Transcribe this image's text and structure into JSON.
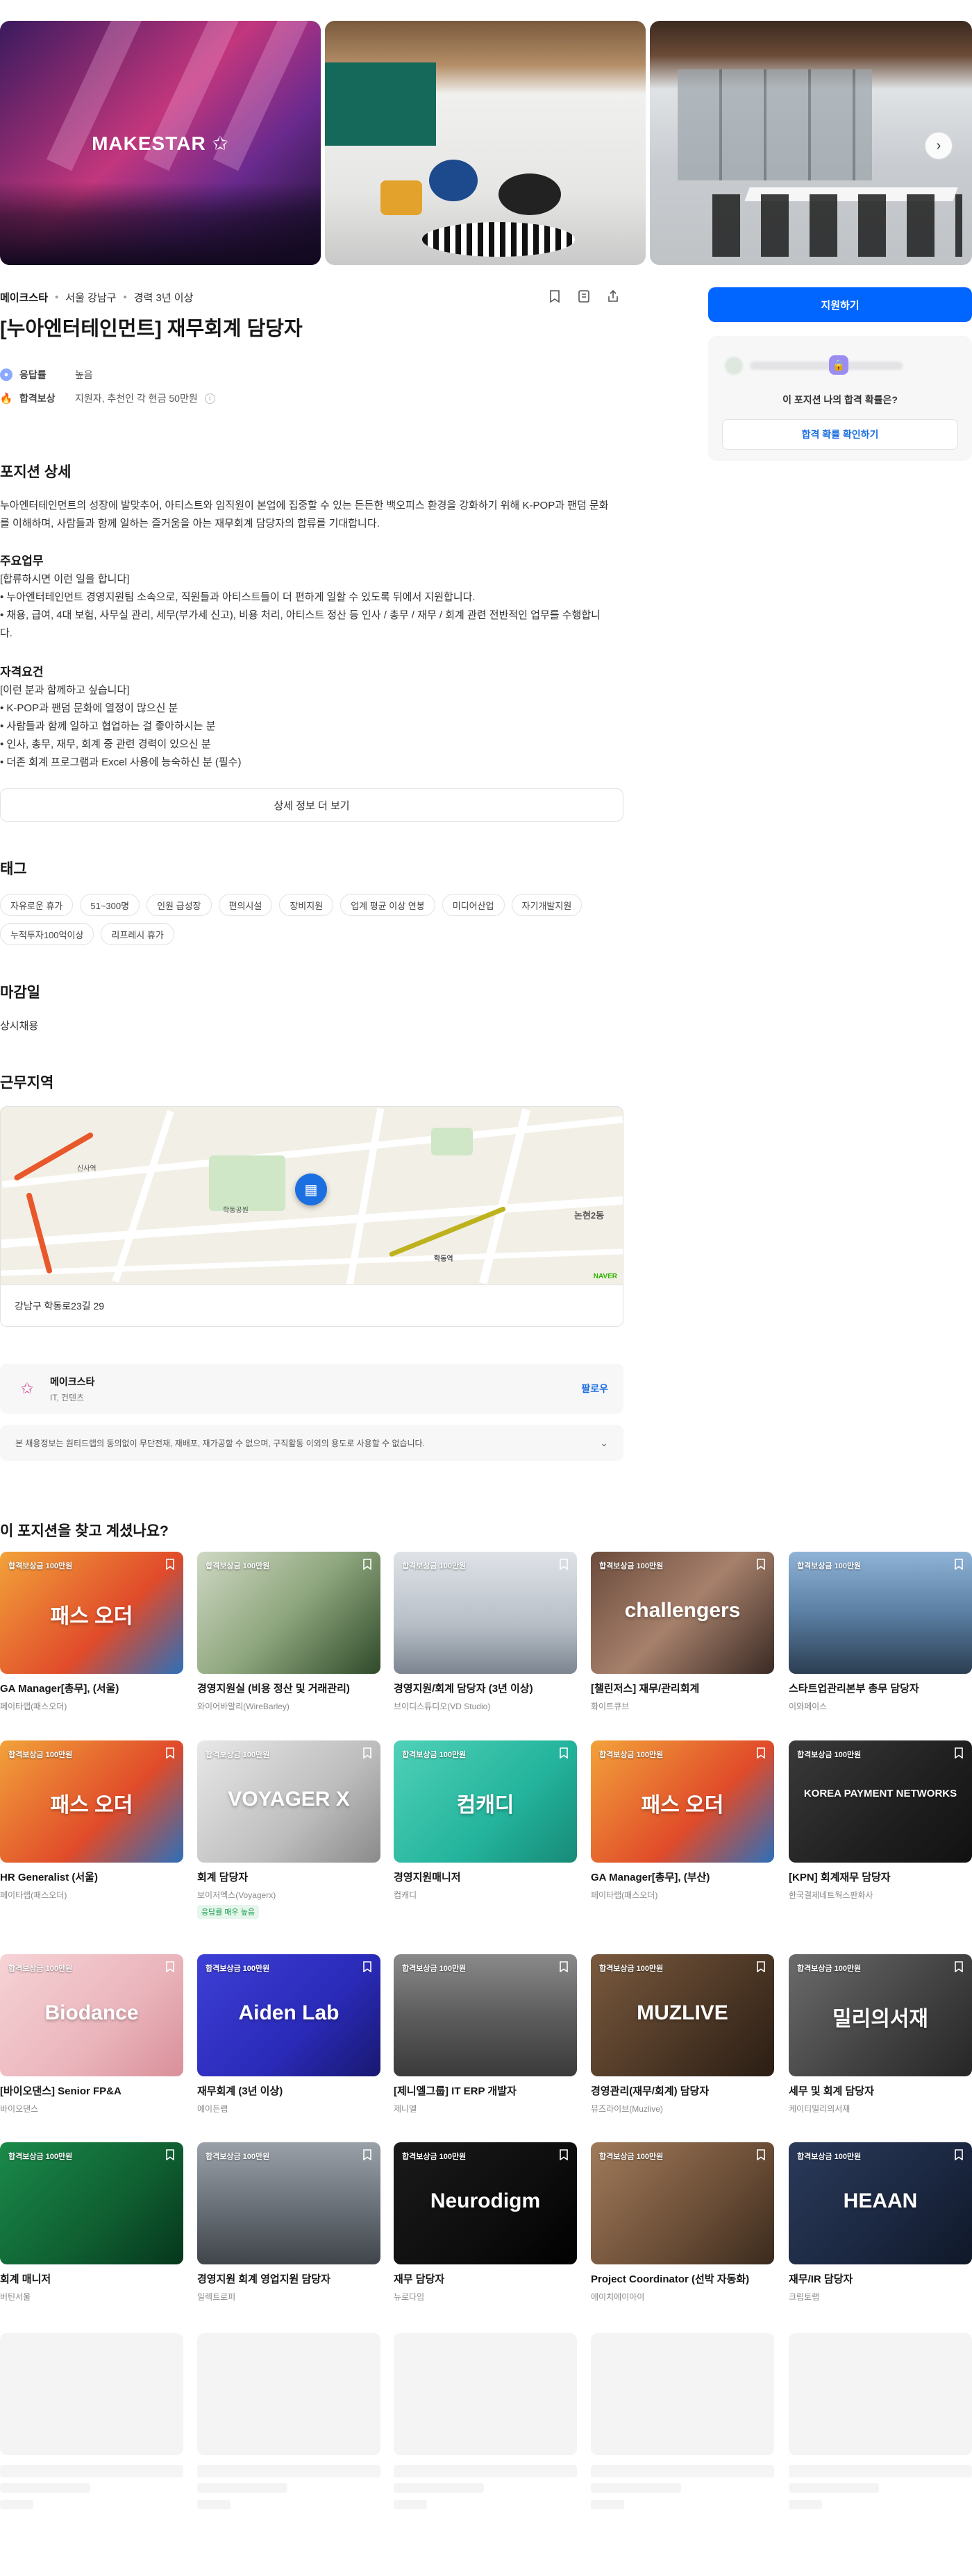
{
  "gallery": {
    "logo_text": "MAKESTAR ✩",
    "next_icon": "chevron-right-icon"
  },
  "header": {
    "company": "메이크스타",
    "location": "서울 강남구",
    "experience": "경력 3년 이상",
    "title": "[누아엔터테인먼트] 재무회계 담당자",
    "icons": [
      "bookmark-icon",
      "share-doc-icon",
      "share-icon"
    ]
  },
  "metrics": [
    {
      "icon": "response-icon",
      "label": "응답률",
      "value": "높음",
      "color": "#8aa8ff"
    },
    {
      "icon": "fire-icon",
      "label": "합격보상",
      "value": "지원자, 추천인 각 현금 50만원",
      "color": "#ff8c2b"
    }
  ],
  "detail": {
    "heading": "포지션 상세",
    "intro_1": "누아엔터테인먼트의 성장에 발맞추어, 아티스트와 임직원이 본업에 집중할 수 있는 든든한 백오피스 환경을 강화하기 위해 K-POP과 팬덤 문화",
    "intro_2": "를 이해하며, 사람들과 함께 일하는 즐거움을 아는 재무회계 담당자의 합류를 기대합니다.",
    "duty_heading": "주요업무",
    "duty_lines": [
      "[합류하시면 이런 일을 합니다]",
      "• 누아엔터테인먼트 경영지원팀 소속으로, 직원들과 아티스트들이 더 편하게 일할 수 있도록 뒤에서 지원합니다.",
      "• 채용, 급여, 4대 보험, 사무실 관리, 세무(부가세 신고), 비용 처리, 아티스트 정산 등 인사 / 총무 / 재무 / 회계 관련 전반적인 업무를 수행합니",
      "다."
    ],
    "req_heading": "자격요건",
    "req_lines": [
      "[이런 분과 함께하고 싶습니다]",
      "• K-POP과 팬덤 문화에 열정이 많으신 분",
      "• 사람들과 함께 일하고 협업하는 걸 좋아하시는 분",
      "• 인사, 총무, 재무, 회계 중 관련 경력이 있으신 분",
      "• 더존 회계 프로그램과 Excel 사용에 능숙하신 분 (필수)"
    ],
    "more_label": "상세 정보 더 보기"
  },
  "tags": {
    "heading": "태그",
    "items": [
      "자유로운 휴가",
      "51~300명",
      "인원 급성장",
      "편의시설",
      "장비지원",
      "업계 평균 이상 연봉",
      "미디어산업",
      "자기개발지원",
      "누적투자100억이상",
      "리프레시 휴가"
    ]
  },
  "deadline": {
    "heading": "마감일",
    "value": "상시채용"
  },
  "location": {
    "heading": "근무지역",
    "address": "강남구 학동로23길 29",
    "map_labels": [
      "신사역",
      "학동공원",
      "논현2동",
      "학동역",
      "NAVER"
    ]
  },
  "company_card": {
    "name": "메이크스타",
    "industry": "IT, 컨텐츠",
    "follow": "팔로우"
  },
  "notice": {
    "text": "본 채용정보는 원티드랩의 동의없이 무단전재, 재배포, 재가공할 수 없으며, 구직활동 이외의 용도로 사용할 수 없습니다."
  },
  "sidebar": {
    "apply_label": "지원하기",
    "question": "이 포지션 나의 합격 확률은?",
    "check_label": "합격 확률 확인하기"
  },
  "recommend": {
    "heading": "이 포지션을 찾고 계셨나요?",
    "badge": "합격보상금 100만원",
    "cards": [
      {
        "pos": "GA Manager[총무], (서울)",
        "co": "페이타랩(패스오더)",
        "thumb": "패스 오더",
        "bg": "linear-gradient(135deg,#f2a23a,#e04b2a 60%,#2d6fb8)"
      },
      {
        "pos": "경영지원실 (비용 정산 및 거래관리)",
        "co": "와이어바알리(WireBarley)",
        "thumb": "",
        "bg": "linear-gradient(135deg,#cfd8c4,#8ea67d 50%,#2f4a2a)"
      },
      {
        "pos": "경영지원/회계 담당자 (3년 이상)",
        "co": "브이디스튜디오(VD Studio)",
        "thumb": "",
        "bg": "linear-gradient(180deg,#dfe3e8,#b7bec6 60%,#7c8590)"
      },
      {
        "pos": "[챌린저스] 재무/관리회계",
        "co": "화이트큐브",
        "thumb": "challengers",
        "bg": "linear-gradient(135deg,#6b4b3c,#a6806b 50%,#3a2a24)"
      },
      {
        "pos": "스타트업관리본부 총무 담당자",
        "co": "이와페이스",
        "thumb": "",
        "bg": "linear-gradient(180deg,#8fb3d6,#5a7fa3 50%,#2c3e52)"
      },
      {
        "pos": "HR Generalist (서울)",
        "co": "페이타랩(패스오더)",
        "thumb": "패스 오더",
        "bg": "linear-gradient(135deg,#f2a23a,#e04b2a 60%,#2d6fb8)"
      },
      {
        "pos": "회계 담당자",
        "co": "보이저엑스(Voyagerx)",
        "thumb": "VOYAGER X",
        "bg": "linear-gradient(135deg,#e8e8e8,#bdbdbd 60%,#8a8a8a)",
        "flag": "응답률 매우 높음"
      },
      {
        "pos": "경영지원매니저",
        "co": "컴캐디",
        "thumb": "컴캐디",
        "bg": "linear-gradient(135deg,#4fd1b8,#23b39c 60%,#178a78)"
      },
      {
        "pos": "GA Manager[총무], (부산)",
        "co": "페이타랩(패스오더)",
        "thumb": "패스 오더",
        "bg": "linear-gradient(135deg,#f2a23a,#e04b2a 60%,#2d6fb8)"
      },
      {
        "pos": "[KPN] 회계재무 담당자",
        "co": "한국결제네트웍스판화사",
        "thumb": "KOREA PAYMENT NETWORKS",
        "bg": "linear-gradient(135deg,#3a3a3a,#1f1f1f 60%,#111)"
      },
      {
        "pos": "[바이오댄스] Senior FP&A",
        "co": "바이오댄스",
        "thumb": "Biodance",
        "bg": "linear-gradient(135deg,#f6d3d6,#eab4bb 60%,#d98f9a)"
      },
      {
        "pos": "재무회계 (3년 이상)",
        "co": "에이든랩",
        "thumb": "Aiden Lab",
        "bg": "linear-gradient(135deg,#3d3fd6,#2a2ab8 60%,#181870)"
      },
      {
        "pos": "[제니엘그룹] IT ERP 개발자",
        "co": "제니엘",
        "thumb": "",
        "bg": "linear-gradient(180deg,#8a8a8a,#5d5d5d 50%,#3a3a3a)"
      },
      {
        "pos": "경영관리(재무/회계) 담당자",
        "co": "뮤즈라이브(Muzlive)",
        "thumb": "MUZLIVE",
        "bg": "linear-gradient(135deg,#7a5a3e,#4a3524 60%,#2a1d14)"
      },
      {
        "pos": "세무 및 회계 담당자",
        "co": "케이티밀리의서재",
        "thumb": "밀리의서재",
        "bg": "linear-gradient(135deg,#6b6b6b,#404040 60%,#262626)"
      },
      {
        "pos": "회계 매니저",
        "co": "버틴서울",
        "thumb": "",
        "bg": "linear-gradient(135deg,#1a8a4a,#0f5e31 60%,#06361c)"
      },
      {
        "pos": "경영지원 회계 영업지원 담당자",
        "co": "일렉트로퍼",
        "thumb": "",
        "bg": "linear-gradient(180deg,#9aa1a8,#6c737a 50%,#3f454a)"
      },
      {
        "pos": "재무 담당자",
        "co": "뉴로다임",
        "thumb": "Neurodigm",
        "bg": "linear-gradient(135deg,#1a1a1a,#0d0d0d 60%,#000)"
      },
      {
        "pos": "Project Coordinator (선박 자동화)",
        "co": "에이치에이아이",
        "thumb": "",
        "bg": "linear-gradient(135deg,#a07a5a,#6a4d36 60%,#3a2a1d)"
      },
      {
        "pos": "재무/IR 담당자",
        "co": "크립토랩",
        "thumb": "HEAAN",
        "bg": "linear-gradient(135deg,#2a3a5a,#1b2740 60%,#0f1828)"
      }
    ]
  },
  "colors": {
    "primary": "#0066ff",
    "accent": "#1b6fe0"
  }
}
